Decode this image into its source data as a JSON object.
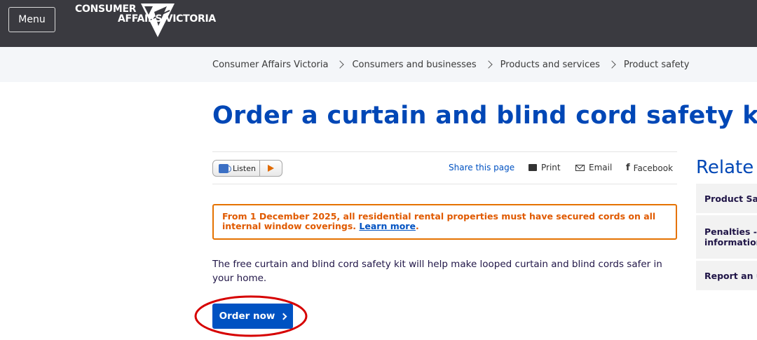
{
  "header": {
    "menu_label": "Menu",
    "logo_line1": "CONSUMER",
    "logo_line2": "AFFAIRS VICTORIA"
  },
  "breadcrumb": [
    "Consumer Affairs Victoria",
    "Consumers and businesses",
    "Products and services",
    "Product safety"
  ],
  "page_title": "Order a curtain and blind cord safety kit",
  "toolbar": {
    "listen_label": "Listen",
    "share_label": "Share this page",
    "print_label": "Print",
    "email_label": "Email",
    "facebook_label": "Facebook"
  },
  "alert": {
    "text": "From 1 December 2025, all residential rental properties must have secured cords on all internal window coverings.",
    "link_text": "Learn more",
    "suffix": "."
  },
  "body_text": "The free curtain and blind cord safety kit will help make looped curtain and blind cords safer in your home.",
  "order_button_label": "Order now",
  "related": {
    "title": "Relate",
    "items": [
      {
        "line1": "Product Sa",
        "line2": ""
      },
      {
        "line1": "Penalties -",
        "line2": "information"
      },
      {
        "line1": "Report an u",
        "line2": ""
      }
    ]
  },
  "colors": {
    "header_bg": "#3a3a40",
    "primary_blue": "#0047b6",
    "button_blue": "#0052c2",
    "alert_orange": "#e57200",
    "annotation_red": "#d60000"
  }
}
